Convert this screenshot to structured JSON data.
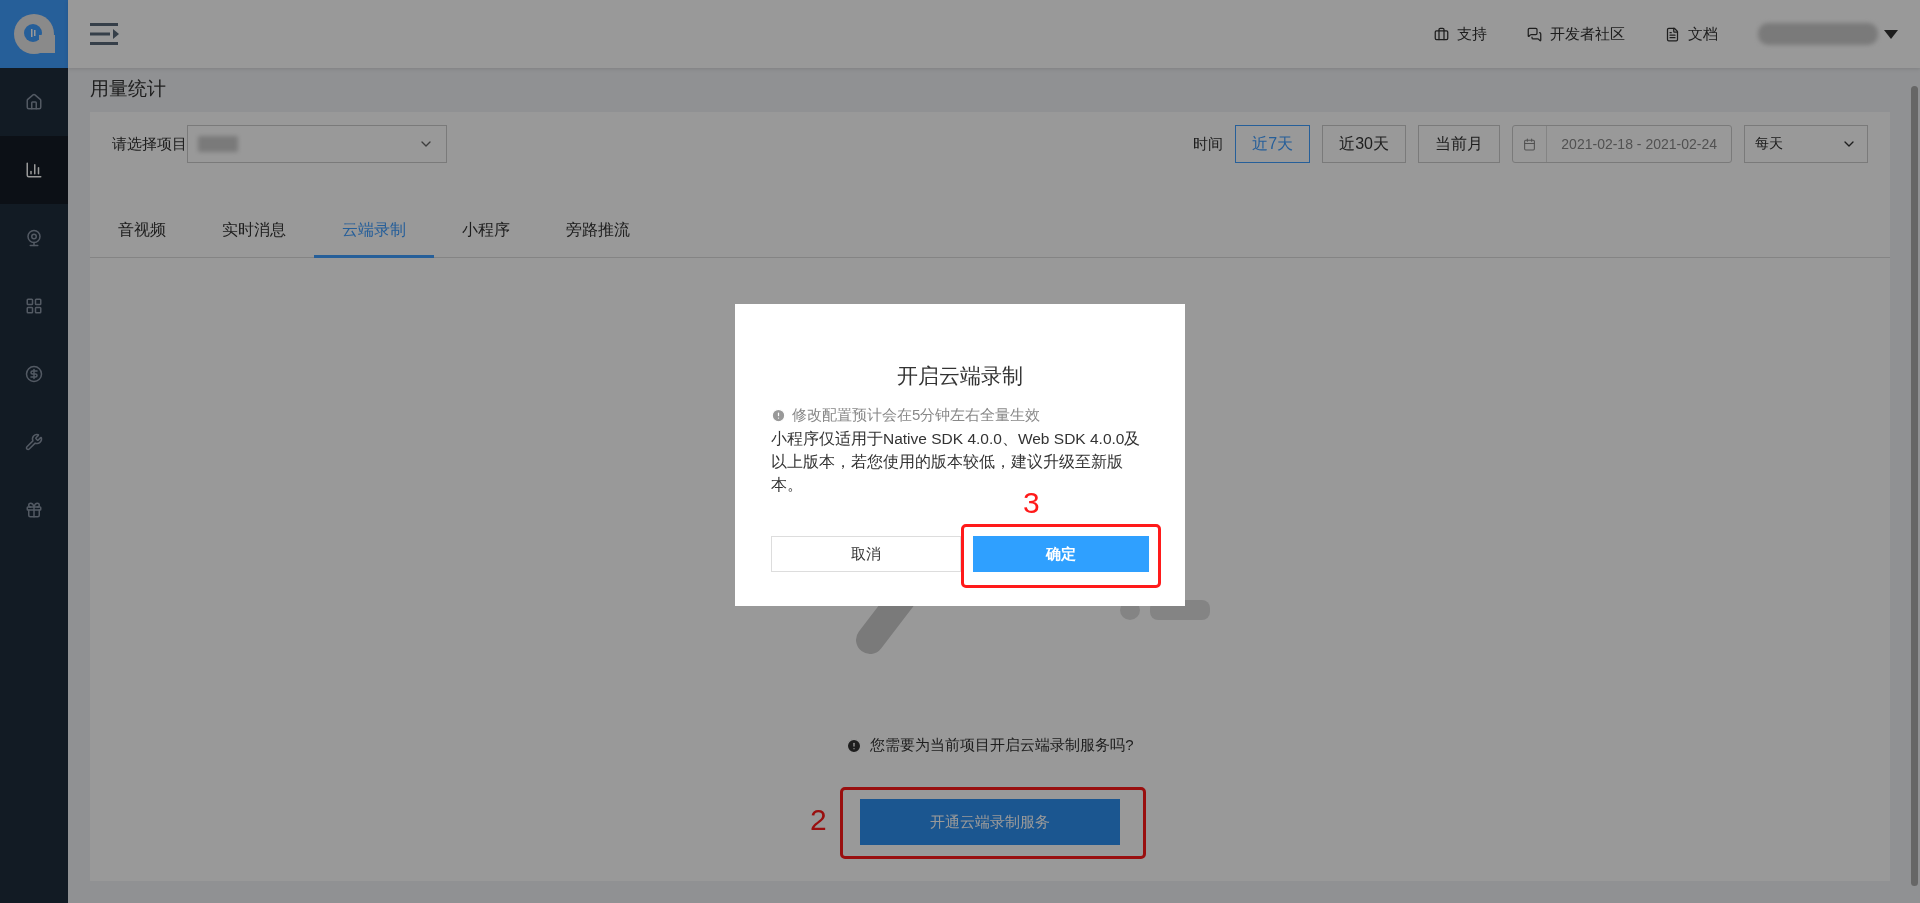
{
  "sidebar": {
    "items": [
      {
        "kind": "home",
        "selected": false
      },
      {
        "kind": "chart",
        "selected": true
      },
      {
        "kind": "camera",
        "selected": false
      },
      {
        "kind": "grid",
        "selected": false
      },
      {
        "kind": "money",
        "selected": false
      },
      {
        "kind": "wrench",
        "selected": false
      },
      {
        "kind": "gift",
        "selected": false
      }
    ]
  },
  "topbar": {
    "links": [
      {
        "kind": "support",
        "label": "支持"
      },
      {
        "kind": "community",
        "label": "开发者社区"
      },
      {
        "kind": "docs",
        "label": "文档"
      }
    ]
  },
  "page_title": "用量统计",
  "filters": {
    "project_label": "请选择项目",
    "time_label": "时间",
    "ranges": [
      {
        "label": "近7天",
        "selected": true
      },
      {
        "label": "近30天",
        "selected": false
      },
      {
        "label": "当前月",
        "selected": false
      }
    ],
    "date_range": "2021-02-18 - 2021-02-24",
    "interval": "每天"
  },
  "tabs": [
    {
      "label": "音视频",
      "selected": false
    },
    {
      "label": "实时消息",
      "selected": false
    },
    {
      "label": "云端录制",
      "selected": true
    },
    {
      "label": "小程序",
      "selected": false
    },
    {
      "label": "旁路推流",
      "selected": false
    }
  ],
  "empty_state": {
    "question": "您需要为当前项目开启云端录制服务吗?",
    "button": "开通云端录制服务",
    "marker": "2"
  },
  "dialog": {
    "title": "开启云端录制",
    "notice": "修改配置预计会在5分钟左右全量生效",
    "body": "小程序仅适用于Native SDK 4.0.0、Web SDK 4.0.0及以上版本，若您使用的版本较低，建议升级至新版本。",
    "cancel": "取消",
    "confirm": "确定",
    "marker": "3"
  }
}
